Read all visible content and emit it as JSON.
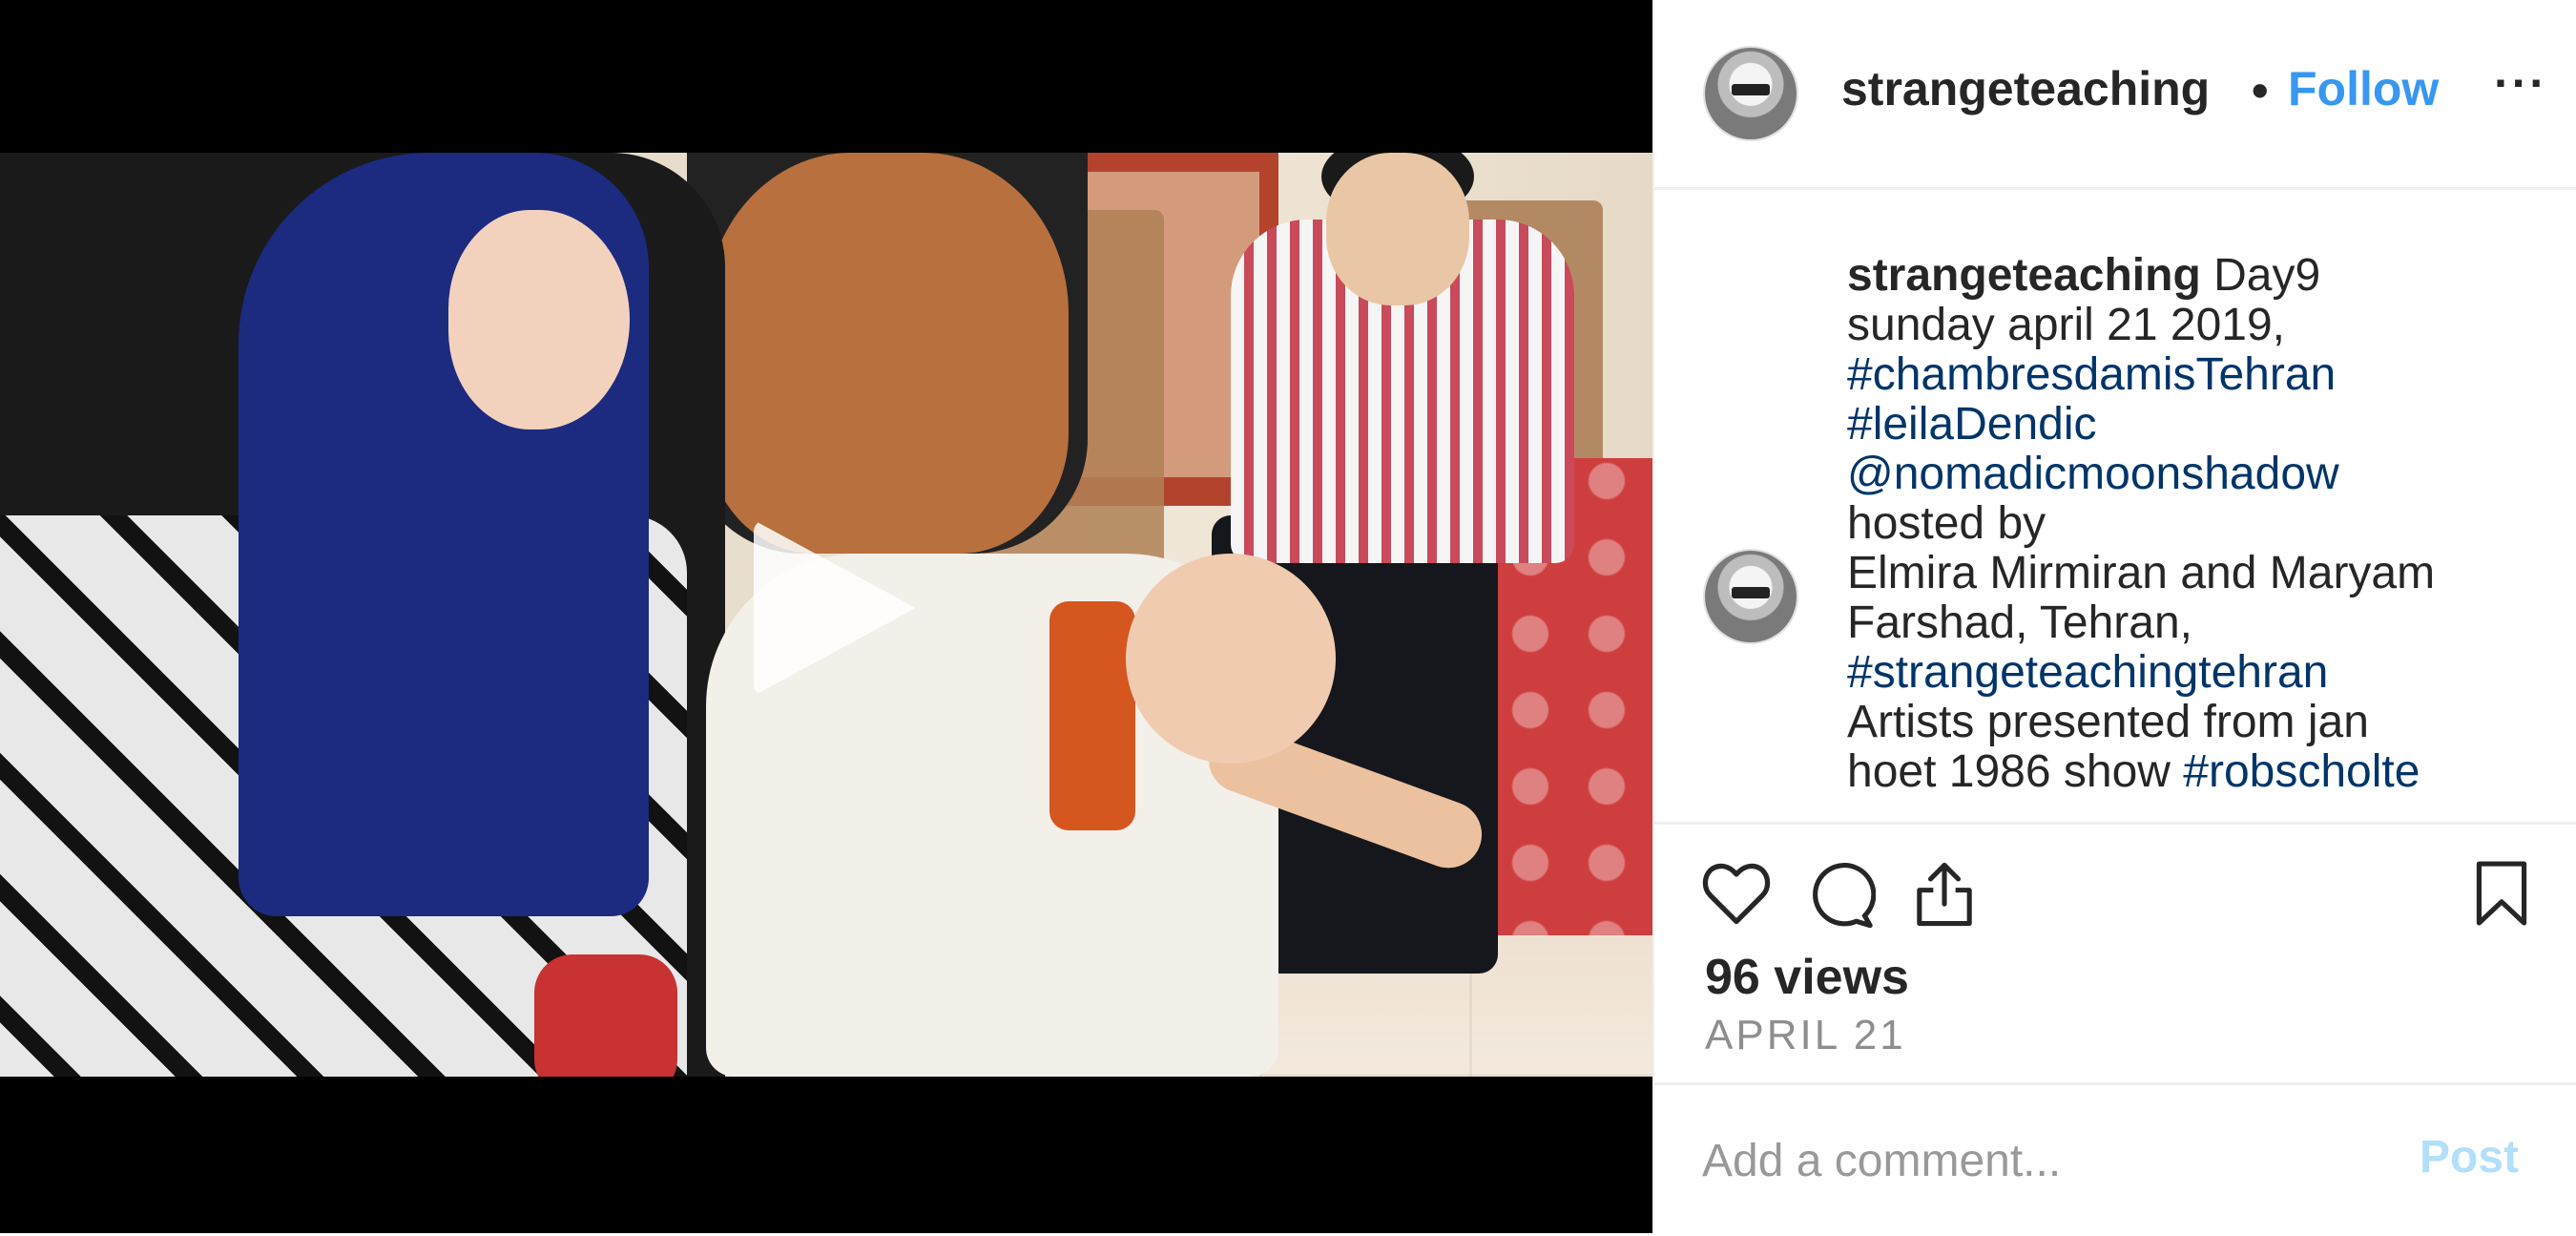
{
  "header": {
    "username": "strangeteaching",
    "separator": "•",
    "follow_label": "Follow",
    "more_label": "···"
  },
  "caption": {
    "username": "strangeteaching",
    "lines": [
      {
        "text": " Day9",
        "type": "text"
      },
      {
        "text": "sunday april 21 2019,",
        "type": "text"
      },
      {
        "text": "#chambresdamisTehran",
        "type": "hashtag"
      },
      {
        "text": "#leilaDendic",
        "type": "hashtag"
      },
      {
        "text": "@nomadicmoonshadow",
        "type": "mention"
      },
      {
        "text": "hosted by",
        "type": "text"
      },
      {
        "text": "Elmira Mirmiran and Maryam",
        "type": "text"
      },
      {
        "text": "Farshad, Tehran,",
        "type": "text"
      },
      {
        "text": "#strangeteachingtehran",
        "type": "hashtag"
      },
      {
        "text": "Artists presented from jan",
        "type": "text"
      },
      {
        "text": "hoet 1986 show ",
        "type": "text"
      },
      {
        "text": "#robscholte",
        "type": "hashtag"
      }
    ]
  },
  "actions": {
    "like_icon": "heart-icon",
    "comment_icon": "comment-icon",
    "share_icon": "share-icon",
    "save_icon": "bookmark-icon"
  },
  "stats": {
    "views": "96 views",
    "date": "APRIL 21"
  },
  "comment_box": {
    "placeholder": "Add a comment...",
    "value": "",
    "post_label": "Post"
  },
  "colors": {
    "link": "#3897f0",
    "hashtag": "#003569",
    "text": "#262626",
    "muted": "#8e8e8e",
    "post_disabled": "#b2dffc"
  }
}
